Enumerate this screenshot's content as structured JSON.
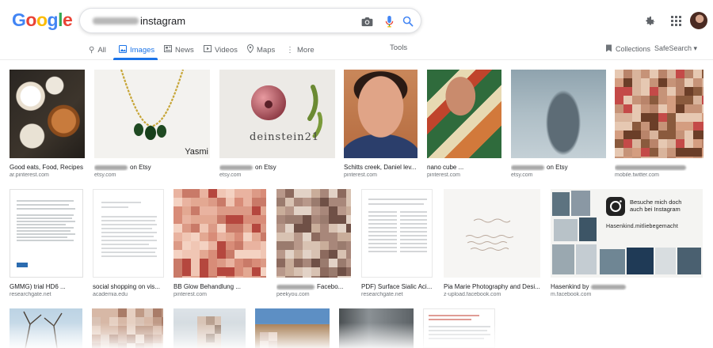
{
  "logo": {
    "letters": [
      "G",
      "o",
      "o",
      "g",
      "l",
      "e"
    ],
    "colors": [
      "#4285F4",
      "#EA4335",
      "#FBBC05",
      "#4285F4",
      "#34A853",
      "#EA4335"
    ]
  },
  "search": {
    "query_visible": "instagram"
  },
  "icons": {
    "camera": "camera-icon",
    "mic": "mic-icon",
    "search": "search-icon",
    "settings": "gear-icon",
    "apps": "apps-grid-icon",
    "account": "avatar"
  },
  "nav": {
    "tabs": [
      {
        "label": "All",
        "icon": "search-icon",
        "active": false
      },
      {
        "label": "Images",
        "icon": "image-icon",
        "active": true
      },
      {
        "label": "News",
        "icon": "news-icon",
        "active": false
      },
      {
        "label": "Videos",
        "icon": "video-icon",
        "active": false
      },
      {
        "label": "Maps",
        "icon": "map-pin-icon",
        "active": false
      },
      {
        "label": "More",
        "icon": "more-icon",
        "active": false
      }
    ],
    "tools": "Tools",
    "collections": "Collections",
    "safesearch": "SafeSearch"
  },
  "colors": {
    "accent": "#1a73e8",
    "text_secondary": "#70757a"
  },
  "results": [
    {
      "caption": "Good eats, Food, Recipes",
      "source": "ar.pinterest.com",
      "redacted_caption": false,
      "suffix": ""
    },
    {
      "caption": "",
      "source": "etsy.com",
      "redacted_caption": true,
      "suffix": "on Etsy",
      "overlay": "Yasmi"
    },
    {
      "caption": "",
      "source": "etsy.com",
      "redacted_caption": true,
      "suffix": "on Etsy",
      "overlay": "deinstein21"
    },
    {
      "caption": "Schitts creek, Daniel lev...",
      "source": "pinterest.com",
      "redacted_caption": false,
      "suffix": ""
    },
    {
      "caption": "nano cube ...",
      "source": "pinterest.com",
      "redacted_caption": false,
      "suffix": ""
    },
    {
      "caption": "",
      "source": "etsy.com",
      "redacted_caption": true,
      "suffix": "on Etsy"
    },
    {
      "caption": "",
      "source": "mobile.twitter.com",
      "redacted_caption": true,
      "suffix": ""
    },
    {
      "caption": "GMMG) trial HD6 ...",
      "source": "researchgate.net",
      "redacted_caption": false,
      "suffix": ""
    },
    {
      "caption": "social shopping on vis...",
      "source": "academia.edu",
      "redacted_caption": false,
      "suffix": ""
    },
    {
      "caption": "BB Glow Behandlung ...",
      "source": "pinterest.com",
      "redacted_caption": false,
      "suffix": ""
    },
    {
      "caption": "",
      "source": "peekyou.com",
      "redacted_caption": true,
      "suffix": "Facebo..."
    },
    {
      "caption": "PDF) Surface Sialic Aci...",
      "source": "researchgate.net",
      "redacted_caption": false,
      "suffix": ""
    },
    {
      "caption": "Pia Marie Photography and Desi...",
      "source": "z-upload.facebook.com",
      "redacted_caption": false,
      "suffix": ""
    },
    {
      "caption": "Hasenkind by",
      "source": "m.facebook.com",
      "redacted_caption": true,
      "suffix": "",
      "overlay": "Besuche mich doch auch bei Instagram",
      "overlay2": "Hasenkind.mitliebegemacht"
    }
  ]
}
